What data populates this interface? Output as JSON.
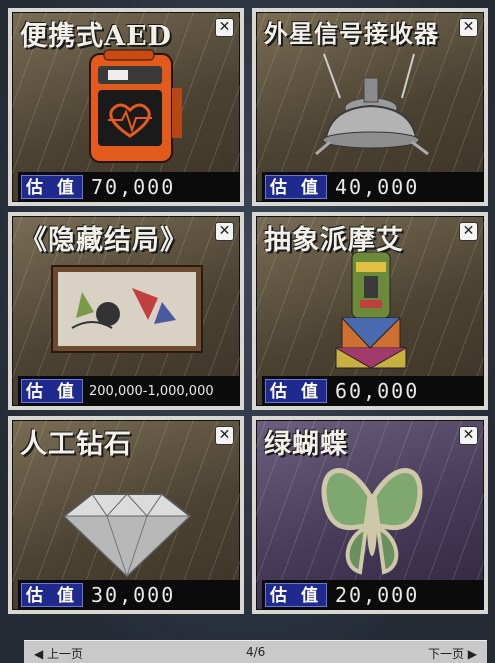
{
  "value_label": "估 值",
  "items": [
    {
      "title": "便携式AED",
      "value": "70,000",
      "icon": "aed-icon"
    },
    {
      "title": "外星信号接收器",
      "value": "40,000",
      "icon": "signal-receiver-icon"
    },
    {
      "title": "《隐藏结局》",
      "value": "200,000-1,000,000",
      "icon": "painting-icon"
    },
    {
      "title": "抽象派摩艾",
      "value": "60,000",
      "icon": "moai-statue-icon"
    },
    {
      "title": "人工钻石",
      "value": "30,000",
      "icon": "diamond-icon"
    },
    {
      "title": "绿蝴蝶",
      "value": "20,000",
      "icon": "butterfly-icon"
    }
  ],
  "close_glyph": "✕",
  "pager": {
    "prev": "◀ 上一页",
    "page": "4/6",
    "next": "下一页 ▶"
  }
}
